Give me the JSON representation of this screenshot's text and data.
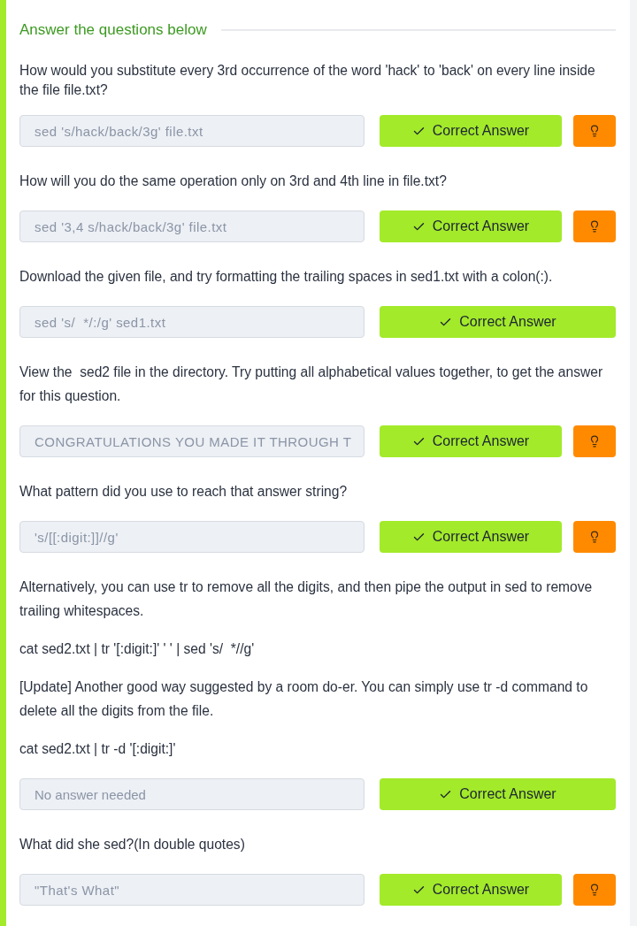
{
  "heading": "Answer the questions below",
  "questions": [
    {
      "paragraphs": [
        "How would you substitute every 3rd occurrence of the word 'hack' to 'back' on every line inside the file file.txt?"
      ],
      "answer": "sed 's/hack/back/3g' file.txt",
      "submit": {
        "label": "Correct Answer",
        "correct": true
      },
      "hint": true
    },
    {
      "paragraphs": [
        "How will you do the same operation only on 3rd and 4th line in file.txt?"
      ],
      "answer": "sed '3,4 s/hack/back/3g' file.txt",
      "submit": {
        "label": "Correct Answer",
        "correct": true
      },
      "hint": true
    },
    {
      "paragraphs": [
        "Download the given file, and try formatting the trailing spaces in sed1.txt with a colon(:)."
      ],
      "answer": "sed 's/  */:/g' sed1.txt",
      "submit": {
        "label": "Correct Answer",
        "correct": true
      },
      "hint": false
    },
    {
      "paragraphs": [
        "View the  sed2 file in the directory. Try putting all alphabetical values together, to get the answer for this question."
      ],
      "answer": "CONGRATULATIONS YOU MADE IT THROUGH T",
      "submit": {
        "label": "Correct Answer",
        "correct": true
      },
      "hint": true
    },
    {
      "paragraphs": [
        "What pattern did you use to reach that answer string?"
      ],
      "answer": "'s/[[:digit:]]//g'",
      "submit": {
        "label": "Correct Answer",
        "correct": true
      },
      "hint": true
    },
    {
      "paragraphs": [
        "Alternatively, you can use tr to remove all the digits, and then pipe the output in sed to remove trailing whitespaces.",
        "cat sed2.txt | tr '[:digit:]' ' ' | sed 's/  *//g'",
        "[Update] Another good way suggested by a room do-er. You can simply use tr -d command to delete all the digits from the file.",
        "cat sed2.txt | tr -d '[:digit:]'"
      ],
      "placeholder": "No answer needed",
      "submit": {
        "label": "Correct Answer",
        "correct": true
      },
      "hint": false
    },
    {
      "paragraphs": [
        "What did she sed?(In double quotes)"
      ],
      "answer": "\"That's What\"",
      "submit": {
        "label": "Correct Answer",
        "correct": true
      },
      "hint": true
    }
  ]
}
